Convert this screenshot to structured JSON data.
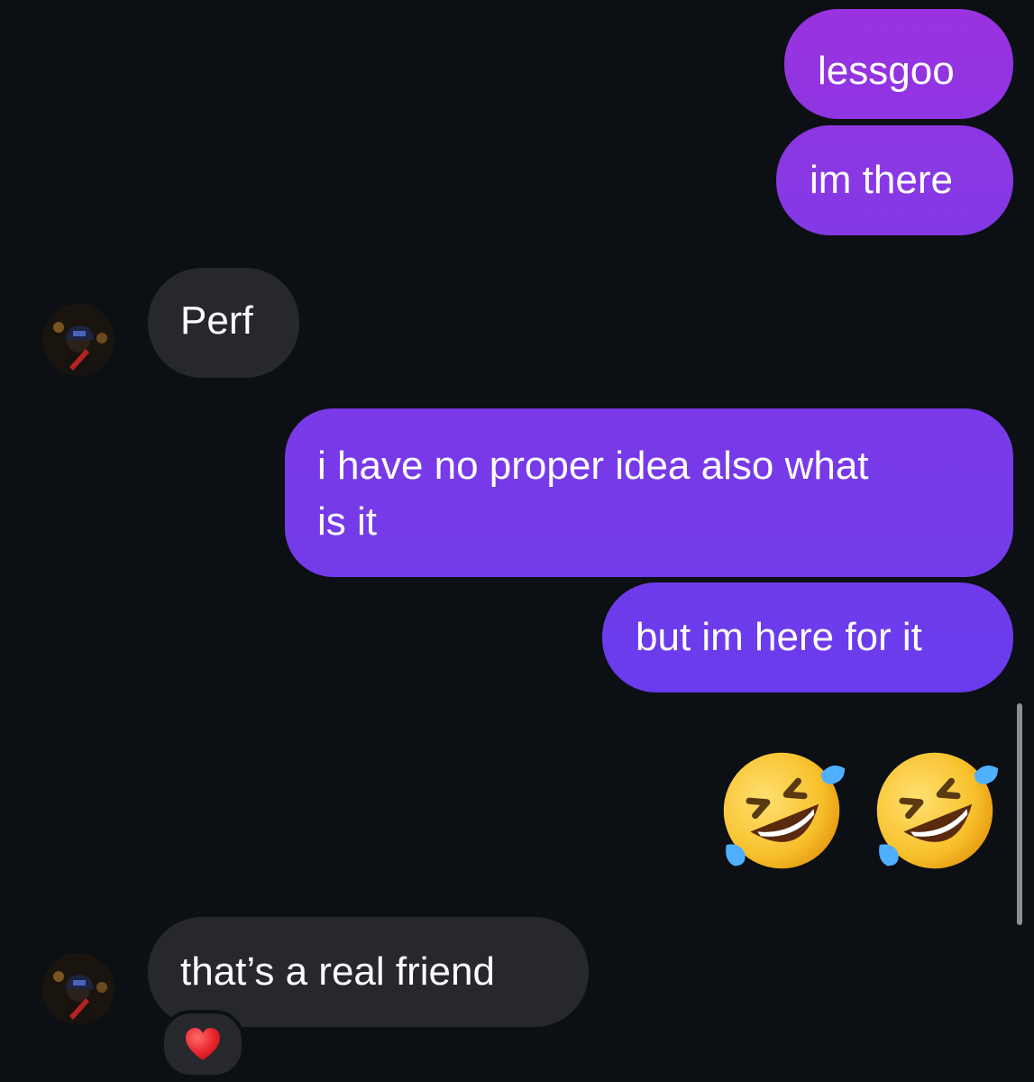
{
  "colors": {
    "background": "#0c0f14",
    "sent_gradient_top": "#9333e0",
    "sent_gradient_bottom": "#6d3bf0",
    "received_bubble": "#26282d"
  },
  "messages": [
    {
      "id": "m1",
      "direction": "sent",
      "text": "lessgoo"
    },
    {
      "id": "m2",
      "direction": "sent",
      "text": "im there"
    },
    {
      "id": "m3",
      "direction": "received",
      "text": "Perf"
    },
    {
      "id": "m4",
      "direction": "sent",
      "text_line1": "i have no proper idea also what",
      "text_line2": "is it"
    },
    {
      "id": "m5",
      "direction": "sent",
      "text": "but im here for it"
    },
    {
      "id": "m6",
      "direction": "sent",
      "emoji": "🤣🤣",
      "icon": "rolling-on-floor-laughing-icon"
    },
    {
      "id": "m7",
      "direction": "received",
      "text": "that’s a real friend",
      "reaction": "❤️",
      "reaction_icon": "red-heart-icon"
    }
  ]
}
